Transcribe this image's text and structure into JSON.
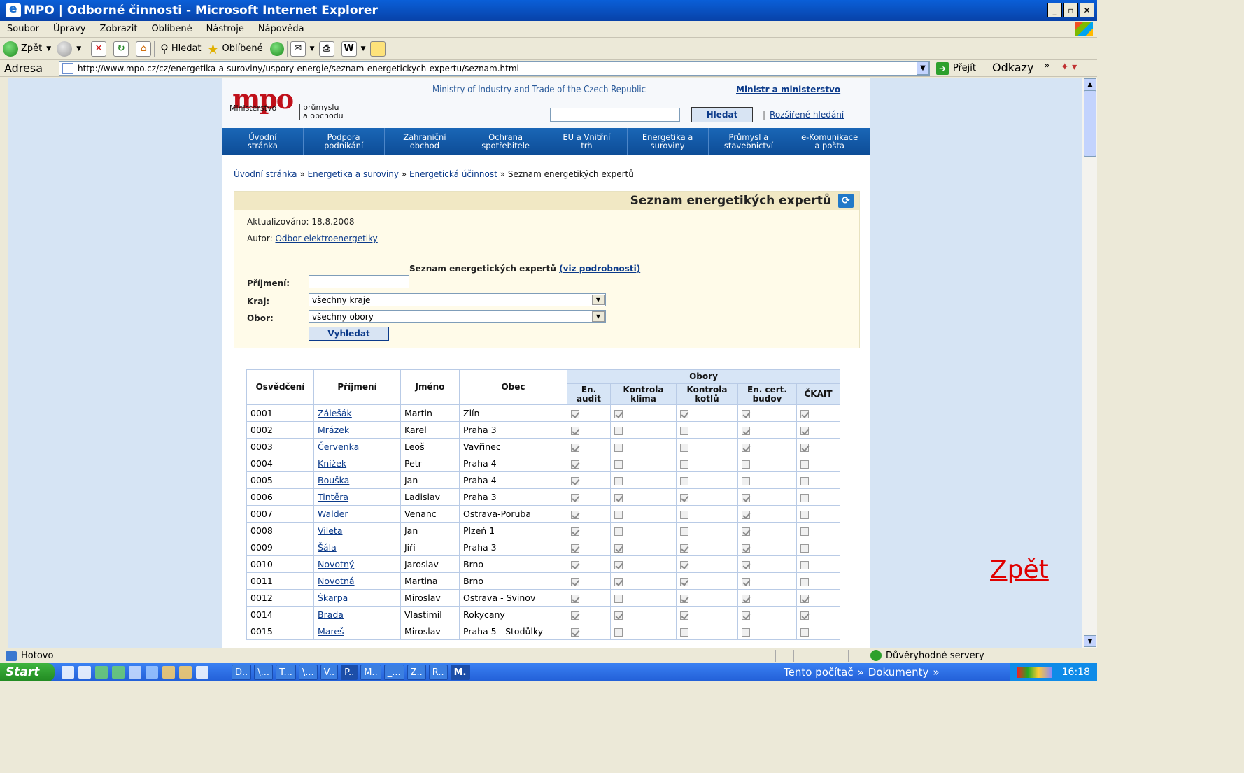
{
  "window": {
    "title": "MPO | Odborné činnosti - Microsoft Internet Explorer"
  },
  "menu": [
    "Soubor",
    "Úpravy",
    "Zobrazit",
    "Oblíbené",
    "Nástroje",
    "Nápověda"
  ],
  "toolbar": {
    "back": "Zpět",
    "search": "Hledat",
    "favorites": "Oblíbené"
  },
  "address": {
    "label": "Adresa",
    "url": "http://www.mpo.cz/cz/energetika-a-suroviny/uspory-energie/seznam-energetickych-expertu/seznam.html",
    "go": "Přejít",
    "links": "Odkazy"
  },
  "site": {
    "logo": "mpo",
    "logo_line1": "Ministerstvo",
    "logo_line2": "průmyslu",
    "logo_line3": "a obchodu",
    "tagline": "Ministry of Industry and Trade of the Czech Republic",
    "minister_link": "Ministr a ministerstvo",
    "search_button": "Hledat",
    "advanced_search": "Rozšířené hledání",
    "nav": [
      {
        "l1": "Úvodní",
        "l2": "stránka"
      },
      {
        "l1": "Podpora",
        "l2": "podnikání"
      },
      {
        "l1": "Zahraniční",
        "l2": "obchod"
      },
      {
        "l1": "Ochrana",
        "l2": "spotřebitele"
      },
      {
        "l1": "EU a Vnitřní",
        "l2": "trh"
      },
      {
        "l1": "Energetika a",
        "l2": "suroviny"
      },
      {
        "l1": "Průmysl a",
        "l2": "stavebnictví"
      },
      {
        "l1": "e-Komunikace",
        "l2": "a pošta"
      }
    ],
    "breadcrumb": [
      "Úvodní stránka",
      "Energetika a suroviny",
      "Energetická účinnost",
      "Seznam energetikých expertů"
    ]
  },
  "content": {
    "heading": "Seznam energetikých expertů",
    "updated": "Aktualizováno: 18.8.2008",
    "author_label": "Autor:",
    "author_link": "Odbor elektroenergetiky",
    "form_title": "Seznam energetických expertů",
    "form_link": "(viz podrobnosti)",
    "surname_label": "Příjmení:",
    "region_label": "Kraj:",
    "region_value": "všechny kraje",
    "field_label": "Obor:",
    "field_value": "všechny obory",
    "search_button": "Vyhledat"
  },
  "table": {
    "headers": {
      "cert": "Osvědčení",
      "surname": "Příjmení",
      "name": "Jméno",
      "city": "Obec",
      "group": "Obory",
      "c1a": "En.",
      "c1b": "audit",
      "c2a": "Kontrola",
      "c2b": "klima",
      "c3a": "Kontrola",
      "c3b": "kotlů",
      "c4a": "En. cert.",
      "c4b": "budov",
      "c5": "ČKAIT"
    },
    "rows": [
      {
        "cert": "0001",
        "surname": "Zálešák",
        "name": "Martin",
        "city": "Zlín",
        "f": [
          1,
          1,
          1,
          1,
          1
        ]
      },
      {
        "cert": "0002",
        "surname": "Mrázek",
        "name": "Karel",
        "city": "Praha 3",
        "f": [
          1,
          0,
          0,
          1,
          1
        ]
      },
      {
        "cert": "0003",
        "surname": "Červenka",
        "name": "Leoš",
        "city": "Vavřinec",
        "f": [
          1,
          0,
          0,
          1,
          1
        ]
      },
      {
        "cert": "0004",
        "surname": "Knížek",
        "name": "Petr",
        "city": "Praha 4",
        "f": [
          1,
          0,
          0,
          0,
          0
        ]
      },
      {
        "cert": "0005",
        "surname": "Bouška",
        "name": "Jan",
        "city": "Praha 4",
        "f": [
          1,
          0,
          0,
          0,
          0
        ]
      },
      {
        "cert": "0006",
        "surname": "Tintěra",
        "name": "Ladislav",
        "city": "Praha 3",
        "f": [
          1,
          1,
          1,
          1,
          0
        ]
      },
      {
        "cert": "0007",
        "surname": "Walder",
        "name": "Venanc",
        "city": "Ostrava-Poruba",
        "f": [
          1,
          0,
          0,
          1,
          0
        ]
      },
      {
        "cert": "0008",
        "surname": "Vileta",
        "name": "Jan",
        "city": "Plzeň 1",
        "f": [
          1,
          0,
          0,
          1,
          0
        ]
      },
      {
        "cert": "0009",
        "surname": "Šála",
        "name": "Jiří",
        "city": "Praha 3",
        "f": [
          1,
          1,
          1,
          1,
          0
        ]
      },
      {
        "cert": "0010",
        "surname": "Novotný",
        "name": "Jaroslav",
        "city": "Brno",
        "f": [
          1,
          1,
          1,
          1,
          0
        ]
      },
      {
        "cert": "0011",
        "surname": "Novotná",
        "name": "Martina",
        "city": "Brno",
        "f": [
          1,
          1,
          1,
          1,
          0
        ]
      },
      {
        "cert": "0012",
        "surname": "Škarpa",
        "name": "Miroslav",
        "city": "Ostrava - Svinov",
        "f": [
          1,
          0,
          1,
          1,
          1
        ]
      },
      {
        "cert": "0014",
        "surname": "Brada",
        "name": "Vlastimil",
        "city": "Rokycany",
        "f": [
          1,
          1,
          1,
          1,
          1
        ]
      },
      {
        "cert": "0015",
        "surname": "Mareš",
        "name": "Miroslav",
        "city": "Praha 5 - Stodůlky",
        "f": [
          1,
          0,
          0,
          0,
          0
        ]
      }
    ]
  },
  "overlay_link": "Zpět",
  "status": {
    "text": "Hotovo",
    "zone": "Důvěryhodné servery"
  },
  "taskbar": {
    "start": "Start",
    "tasks": [
      "D..",
      "\\...",
      "T...",
      "\\...",
      "V..",
      "P..",
      "M..",
      "_...",
      "Z..",
      "R..",
      "M."
    ],
    "extra1": "Tento počítač",
    "extra2": "Dokumenty",
    "clock": "16:18"
  }
}
